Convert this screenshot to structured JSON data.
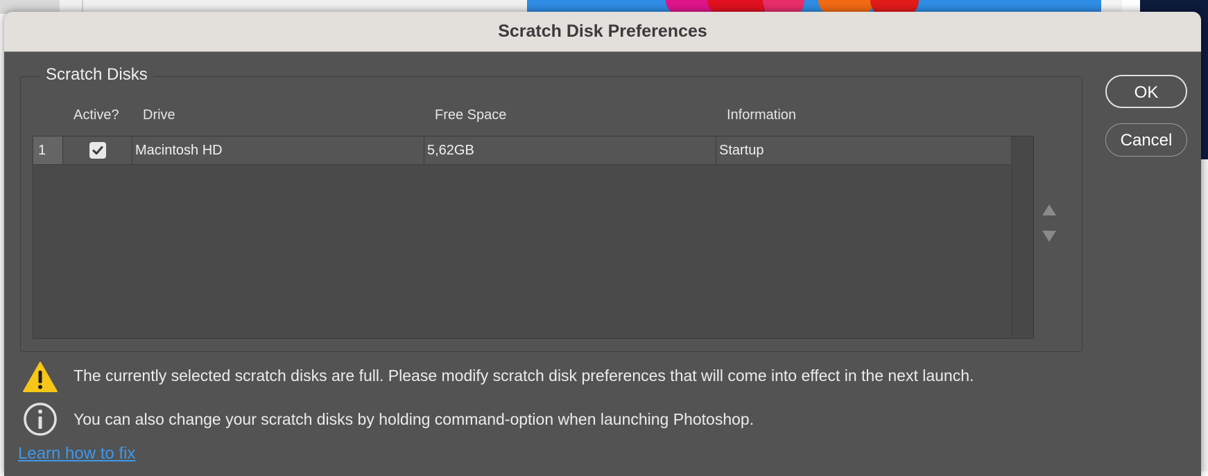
{
  "dialog": {
    "title": "Scratch Disk Preferences",
    "group_title": "Scratch Disks",
    "columns": [
      "Active?",
      "Drive",
      "Free Space",
      "Information"
    ],
    "rows": [
      {
        "index": "1",
        "active": true,
        "drive": "Macintosh HD",
        "free_space": "5,62GB",
        "information": "Startup"
      }
    ],
    "buttons": {
      "ok": "OK",
      "cancel": "Cancel"
    },
    "warning_text": "The currently selected scratch disks are full. Please modify scratch disk preferences that will come into effect in the next launch.",
    "info_text": "You can also change your scratch disks by holding command-option when launching Photoshop.",
    "link_text": "Learn how to fix",
    "icons": {
      "warning": "warning-icon",
      "info": "info-icon",
      "checkbox": "checkmark-icon",
      "move_up": "triangle-up-icon",
      "move_down": "triangle-down-icon"
    },
    "colors": {
      "dialog_bg": "#535353",
      "titlebar_bg": "#e3dfdb",
      "warning_yellow": "#f6c619",
      "link_blue": "#3d98ec"
    }
  }
}
